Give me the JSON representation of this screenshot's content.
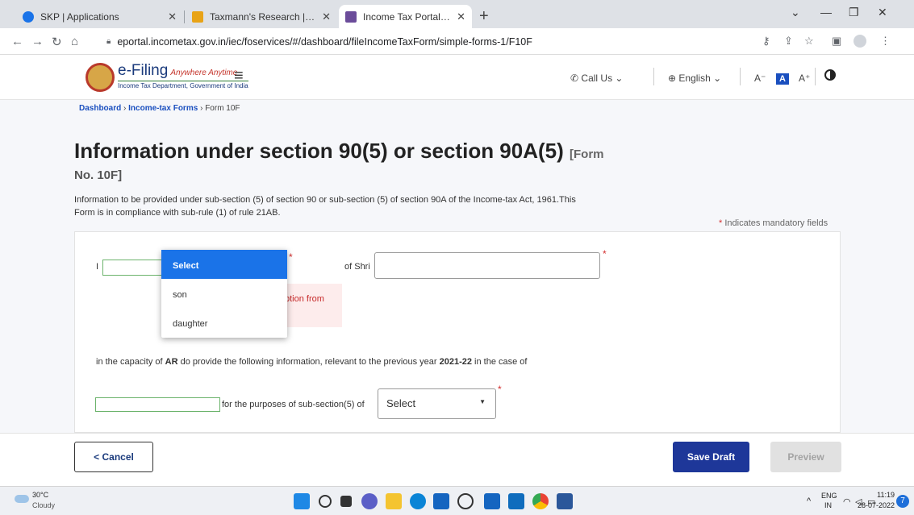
{
  "browser": {
    "tabs": [
      {
        "title": "SKP | Applications",
        "favicon_color": "#1a73e8"
      },
      {
        "title": "Taxmann's Research | Income Tax",
        "favicon_color": "#e8a317"
      },
      {
        "title": "Income Tax Portal, Government of",
        "favicon_color": "#6b4c9a"
      }
    ],
    "new_tab_icon": "plus-icon",
    "url": "eportal.incometax.gov.in/iec/foservices/#/dashboard/fileIncomeTaxForm/simple-forms-1/F10F"
  },
  "site": {
    "logo_text": "e-Filing",
    "logo_tagline": "Anywhere Anytime",
    "dept_text": "Income Tax Department, Government of India",
    "call_us": "Call Us",
    "language": "English",
    "font_decrease": "A",
    "font_normal": "A",
    "font_increase": "A"
  },
  "breadcrumb": {
    "dashboard": "Dashboard",
    "forms": "Income-tax Forms",
    "current": "Form 10F",
    "sep": "›"
  },
  "page": {
    "title": "Information under section 90(5) or section 90A(5)",
    "form_tag": "[Form",
    "title_line2": "No. 10F]",
    "description": "Information to be provided under sub-section (5) of section 90 or sub-section (5) of section 90A of the Income-tax Act, 1961.This Form is in compliance with sub-rule (1) of rule 21AB.",
    "mandatory_note": "Indicates mandatory fields",
    "mandatory_star": "*"
  },
  "form": {
    "i_label": "I",
    "of_shri_label": "of Shri",
    "error_text": "ption from",
    "capacity_prefix": "in the capacity of",
    "capacity_value": "AR",
    "capacity_middle": "do provide the following information, relevant to the previous year",
    "previous_year": "2021-22",
    "capacity_suffix": "in the case of",
    "purpose_label": "for the purposes of sub-section(5) of",
    "section_select": "Select",
    "required_star": "*"
  },
  "dropdown": {
    "options": [
      "Select",
      "son",
      "daughter"
    ],
    "selected": "Select"
  },
  "footer": {
    "cancel": "< Cancel",
    "save_draft": "Save Draft",
    "preview": "Preview"
  },
  "taskbar": {
    "temperature": "30°C",
    "weather": "Cloudy",
    "lang": "ENG",
    "region": "IN",
    "time": "11:19",
    "date": "28-07-2022",
    "notifications": "7"
  },
  "colors": {
    "accent": "#1e3799",
    "dropdown_selected": "#1a73e8",
    "error": "#d32f2f",
    "valid_border": "#6bb36b"
  }
}
